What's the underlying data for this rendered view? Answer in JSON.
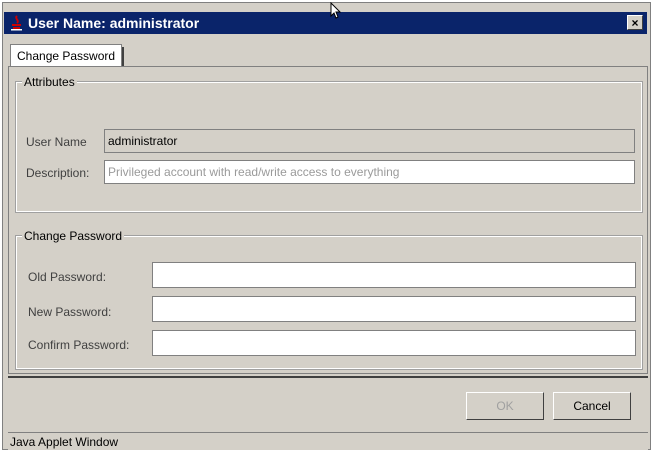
{
  "window": {
    "title": "User Name: administrator",
    "close_glyph": "×"
  },
  "tabs": [
    {
      "label": "Change Password",
      "active": true
    }
  ],
  "attributes": {
    "legend": "Attributes",
    "user_name_label": "User Name",
    "user_name_value": "administrator",
    "description_label": "Description:",
    "description_value": "Privileged account with read/write access to everything"
  },
  "change_password": {
    "legend": "Change Password",
    "old_label": "Old Password:",
    "new_label": "New Password:",
    "confirm_label": "Confirm Password:",
    "old_value": "",
    "new_value": "",
    "confirm_value": ""
  },
  "buttons": {
    "ok_label": "OK",
    "ok_enabled": false,
    "cancel_label": "Cancel"
  },
  "status_bar": {
    "text": "Java Applet Window"
  },
  "colors": {
    "title_bar": "#0a246a",
    "dialog_bg": "#d4d0c8",
    "icon_red": "#cc0000"
  }
}
